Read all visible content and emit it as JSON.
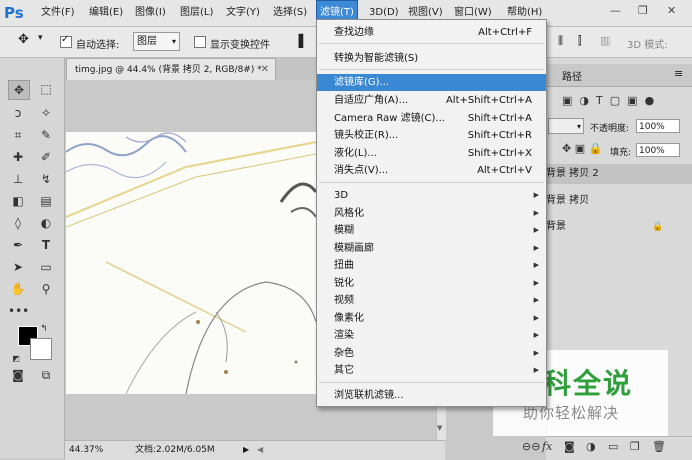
{
  "app": {
    "logo": "Ps"
  },
  "menubar": {
    "items": [
      "文件(F)",
      "编辑(E)",
      "图像(I)",
      "图层(L)",
      "文字(Y)",
      "选择(S)",
      "滤镜(T)",
      "3D(D)",
      "视图(V)",
      "窗口(W)",
      "帮助(H)"
    ],
    "active": "滤镜(T)"
  },
  "options_bar": {
    "auto_select_label": "自动选择:",
    "auto_select_value": "图层",
    "show_transform_label": "显示变换控件",
    "mode_3d_label": "3D 模式:"
  },
  "document": {
    "tab_title": "timg.jpg @ 44.4% (背景 拷贝 2, RGB/8#) *",
    "zoom": "44.37%",
    "doc_info": "文档:2.02M/6.05M"
  },
  "filter_menu": {
    "top_items": [
      {
        "label": "查找边缘",
        "shortcut": "Alt+Ctrl+F"
      },
      {
        "label": "转换为智能滤镜(S)",
        "shortcut": ""
      }
    ],
    "mid_items": [
      {
        "label": "滤镜库(G)...",
        "shortcut": ""
      },
      {
        "label": "自适应广角(A)...",
        "shortcut": "Alt+Shift+Ctrl+A"
      },
      {
        "label": "Camera Raw 滤镜(C)...",
        "shortcut": "Shift+Ctrl+A"
      },
      {
        "label": "镜头校正(R)...",
        "shortcut": "Shift+Ctrl+R"
      },
      {
        "label": "液化(L)...",
        "shortcut": "Shift+Ctrl+X"
      },
      {
        "label": "消失点(V)...",
        "shortcut": "Alt+Ctrl+V"
      }
    ],
    "sub_items": [
      "3D",
      "风格化",
      "模糊",
      "模糊画廊",
      "扭曲",
      "锐化",
      "视频",
      "像素化",
      "渲染",
      "杂色",
      "其它"
    ],
    "browse": "浏览联机滤镜..."
  },
  "panel": {
    "tab": "路径",
    "opacity_label": "不透明度:",
    "opacity_value": "100%",
    "fill_label": "填充:",
    "fill_value": "100%",
    "layers": [
      "背景 拷贝 2",
      "背景 拷贝",
      "背景"
    ]
  },
  "watermark": {
    "logo": "百科全说",
    "sub": "助你轻松解决"
  },
  "colors": {
    "highlight": "#3a87d4",
    "menubar": "#e6e6e6",
    "watermark_green": "#2e9f3a"
  }
}
